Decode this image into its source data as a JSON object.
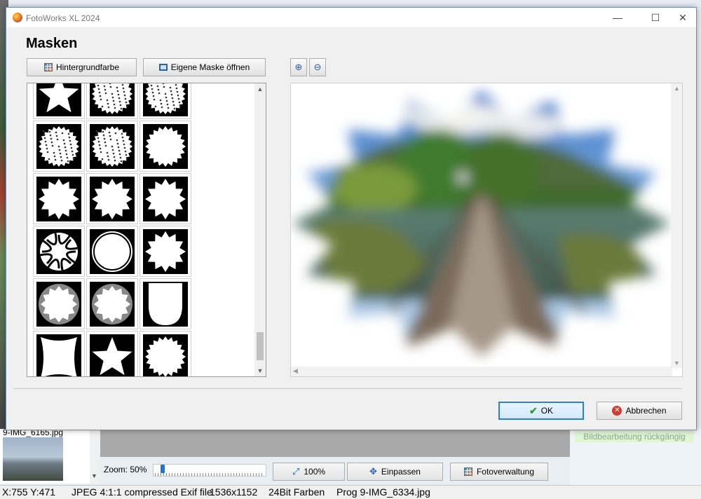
{
  "app": {
    "title": "FotoWorks XL 2024"
  },
  "window_controls": {
    "minimize": "—",
    "maximize": "☐",
    "close": "✕"
  },
  "dialog": {
    "heading": "Masken",
    "background_color_button": "Hintergrundfarbe",
    "open_mask_button": "Eigene Maske öffnen",
    "zoom_in_icon": "magnifier-plus-icon",
    "zoom_out_icon": "magnifier-minus-icon",
    "ok_button": "OK",
    "cancel_button": "Abbrechen"
  },
  "background": {
    "file_label": "9-IMG_6165.jpg",
    "undo_label": "Bildbearbeitung rückgängig",
    "zoom_label": "Zoom: 50%",
    "zoom_level": 0.05,
    "btn_100": "100%",
    "btn_fit": "Einpassen",
    "btn_manager": "Fotoverwaltung"
  },
  "statusbar": {
    "coords": "X:755 Y:471",
    "format": "JPEG 4:1:1 compressed Exif file",
    "dimensions": "1536x1152",
    "color_depth": "24Bit Farben",
    "filename": "Prog 9-IMG_6334.jpg"
  },
  "colors": {
    "accent": "#2a7fd4",
    "cancel": "#d53a2e",
    "undo_bg": "#dff5d4"
  },
  "mask_shapes": [
    "star",
    "noise-burst",
    "noise-burst",
    "noise-burst",
    "noise-burst",
    "sawtooth-circle",
    "star-12",
    "star-12",
    "star-12",
    "swirl",
    "ring-circle",
    "star-12",
    "soft-star",
    "soft-star",
    "shield",
    "badge",
    "star",
    "sawtooth-circle"
  ]
}
